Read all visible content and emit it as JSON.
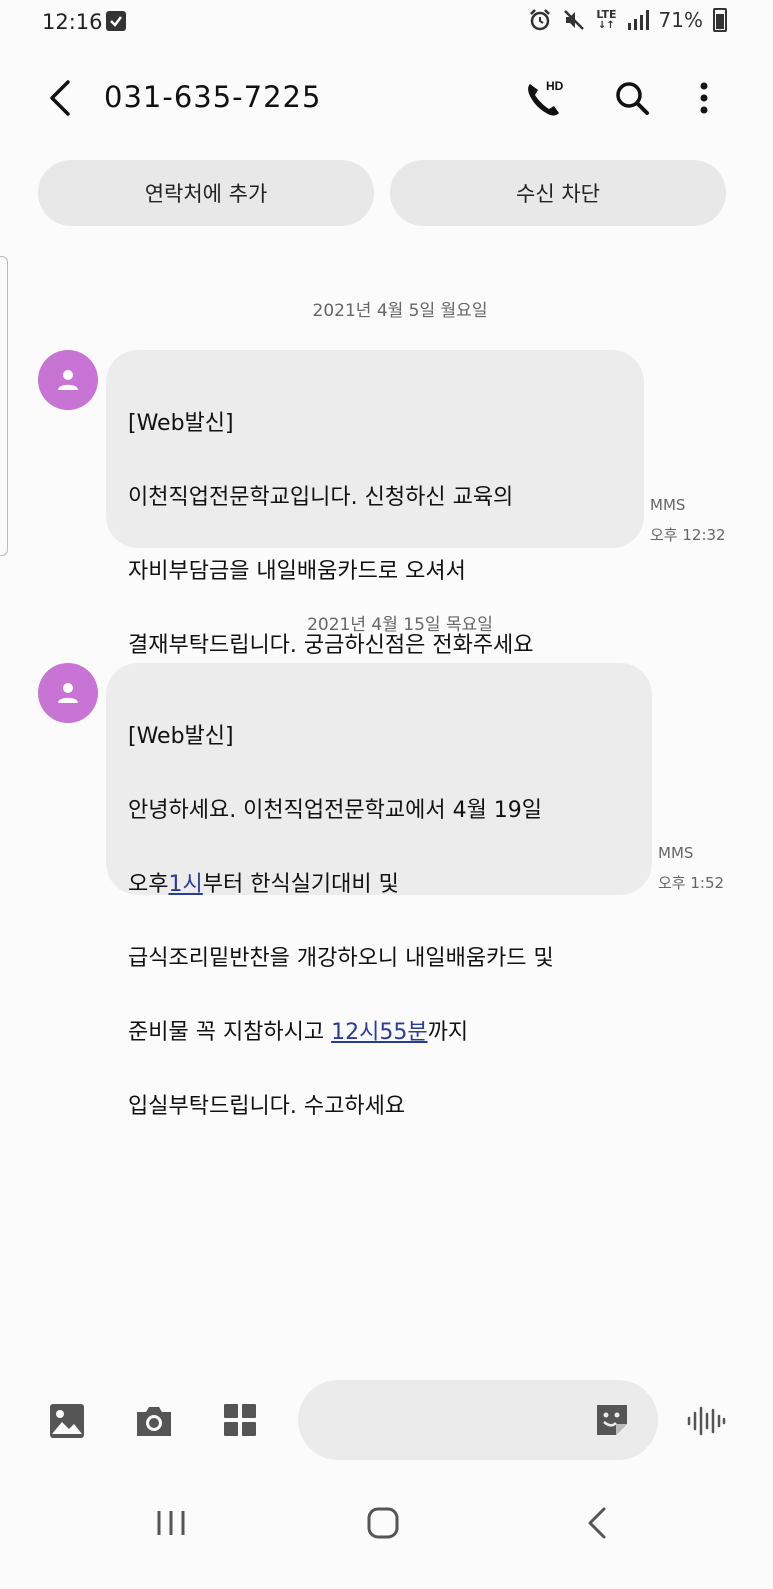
{
  "status_bar": {
    "time": "12:16",
    "network": "LTE",
    "battery": "71%"
  },
  "header": {
    "contact_number": "031-635-7225",
    "hd_label": "HD"
  },
  "actions": {
    "add_contact": "연락처에 추가",
    "block": "수신 차단"
  },
  "conversation": [
    {
      "date": "2021년 4월 5일 월요일",
      "message": {
        "lines": [
          "[Web발신]",
          "이천직업전문학교입니다. 신청하신 교육의",
          "자비부담금을 내일배움카드로 오셔서",
          "결재부탁드립니다.  궁금하신점은 전화주세요"
        ],
        "link": "031-635-7225",
        "type": "MMS",
        "time": "오후 12:32"
      }
    },
    {
      "date": "2021년 4월 15일 목요일",
      "message": {
        "line1": "[Web발신]",
        "line2": "안녕하세요. 이천직업전문학교에서 4월 19일",
        "line3_pre": "오후",
        "line3_link": "1시",
        "line3_post": "부터  한식실기대비 및",
        "line4": "급식조리밑반찬을 개강하오니 내일배움카드 및",
        "line5_pre": "준비물 꼭 지참하시고 ",
        "line5_link": "12시55분",
        "line5_post": "까지",
        "line6": "입실부탁드립니다. 수고하세요",
        "type": "MMS",
        "time": "오후 1:52"
      }
    }
  ],
  "composer": {
    "placeholder": ""
  },
  "colors": {
    "avatar": "#c774d4",
    "bubble": "#ececec",
    "link": "#283b9c",
    "pill": "#e8e8e8"
  }
}
